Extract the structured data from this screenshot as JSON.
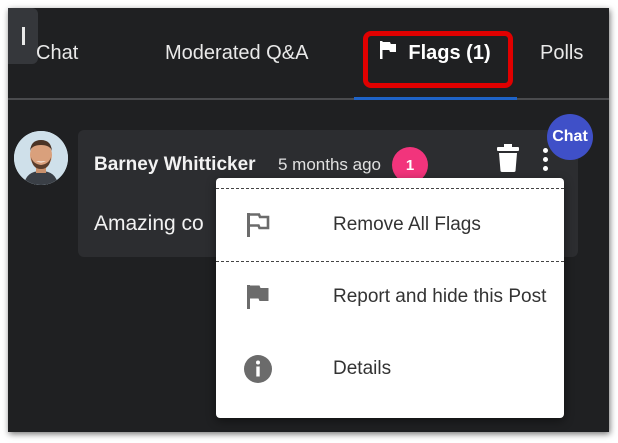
{
  "tabs": {
    "chat": "Chat",
    "moderated": "Moderated Q&A",
    "flags": "Flags (1)",
    "polls": "Polls"
  },
  "post": {
    "author": "Barney Whitticker",
    "time": "5 months ago",
    "flag_count": "1",
    "message": "Amazing co"
  },
  "chat_badge": "Chat",
  "menu": {
    "items": [
      {
        "label": "Remove All Flags",
        "icon": "flag-outline-icon"
      },
      {
        "label": "Report and hide this Post",
        "icon": "flag-filled-icon"
      },
      {
        "label": "Details",
        "icon": "info-icon"
      }
    ]
  },
  "colors": {
    "background": "#1f2022",
    "card": "#2c2d30",
    "highlight": "#e00000",
    "active_tab_underline": "#1e63c8",
    "badge_pink": "#f2347c",
    "chat_badge": "#3f50c8"
  }
}
